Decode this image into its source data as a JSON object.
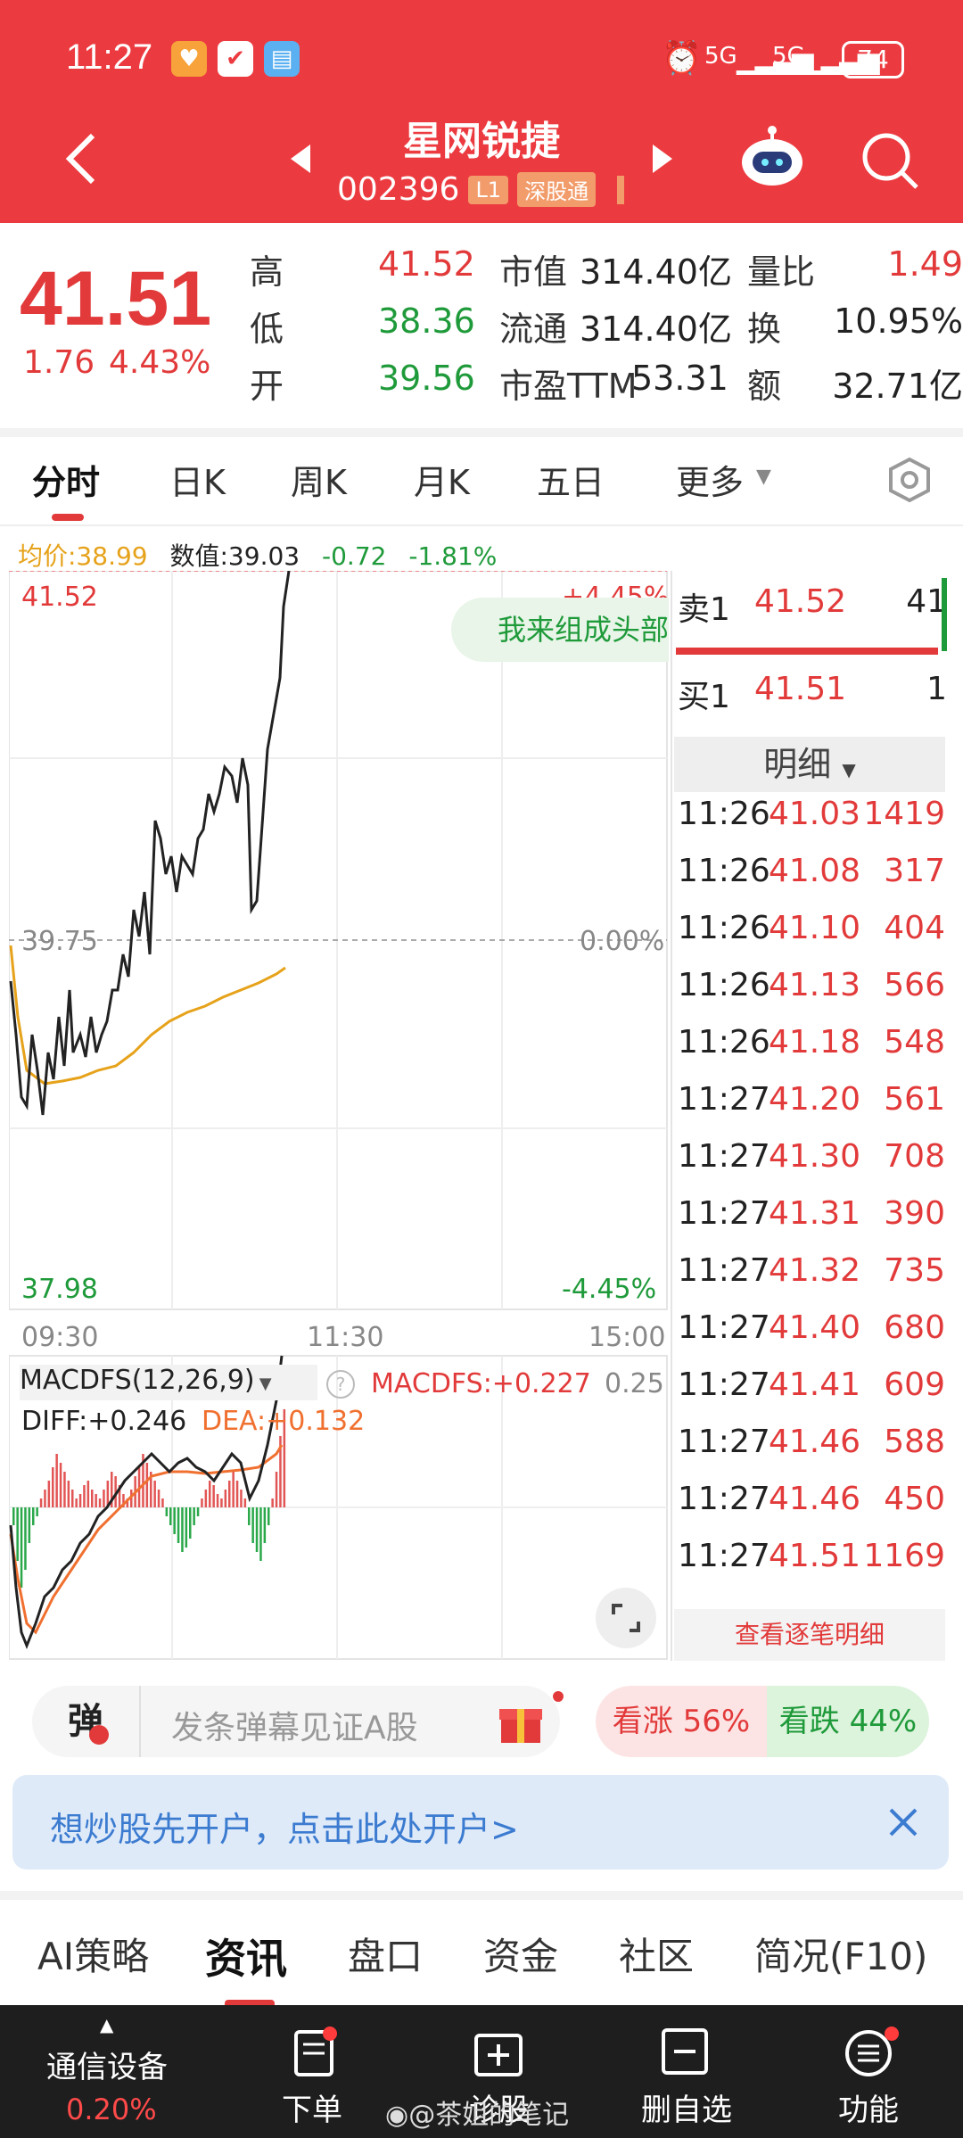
{
  "status_bar": {
    "time": "11:27",
    "signal1": "5G",
    "signal2": "5G",
    "battery": "74"
  },
  "header": {
    "title": "星网锐捷",
    "code": "002396",
    "badge_level": "L1",
    "badge_market": "深股通"
  },
  "quote": {
    "price": "41.51",
    "change": "1.76",
    "change_pct": "4.43%",
    "rows": [
      {
        "l1": "高",
        "v1": "41.52",
        "l2": "市值",
        "v2": "314.40亿",
        "l3": "量比",
        "v3": "1.49"
      },
      {
        "l1": "低",
        "v1": "38.36",
        "l2": "流通",
        "v2": "314.40亿",
        "l3": "换",
        "v3": "10.95%"
      },
      {
        "l1": "开",
        "v1": "39.56",
        "l2": "市盈TTM",
        "v2": "53.31",
        "l3": "额",
        "v3": "32.71亿"
      }
    ]
  },
  "tabs": [
    "分时",
    "日K",
    "周K",
    "月K",
    "五日",
    "更多"
  ],
  "info_line": {
    "avg_label": "均价:38.99",
    "value_label": "数值:39.03",
    "chg": "-0.72",
    "chg_pct": "-1.81%"
  },
  "chart_labels": {
    "top_price": "41.52",
    "top_pct": "+4.45%",
    "mid_price": "39.75",
    "mid_pct": "0.00%",
    "bottom_price": "37.98",
    "bottom_pct": "-4.45%",
    "time_start": "09:30",
    "time_mid": "11:30",
    "time_end": "15:00",
    "bubble": "我来组成头部"
  },
  "macd": {
    "name": "MACDFS(12,26,9)",
    "macdfs": "MACDFS:+0.227",
    "scale": "0.25",
    "diff": "DIFF:+0.246",
    "dea": "DEA:+0.132"
  },
  "order_book": {
    "sell": {
      "label": "卖1",
      "price": "41.52",
      "qty": "41"
    },
    "buy": {
      "label": "买1",
      "price": "41.51",
      "qty": "1"
    }
  },
  "detail": {
    "header": "明细",
    "rows": [
      {
        "t": "11:26",
        "p": "41.03",
        "q": "1419"
      },
      {
        "t": "11:26",
        "p": "41.08",
        "q": "317"
      },
      {
        "t": "11:26",
        "p": "41.10",
        "q": "404"
      },
      {
        "t": "11:26",
        "p": "41.13",
        "q": "566"
      },
      {
        "t": "11:26",
        "p": "41.18",
        "q": "548"
      },
      {
        "t": "11:27",
        "p": "41.20",
        "q": "561"
      },
      {
        "t": "11:27",
        "p": "41.30",
        "q": "708"
      },
      {
        "t": "11:27",
        "p": "41.31",
        "q": "390"
      },
      {
        "t": "11:27",
        "p": "41.32",
        "q": "735"
      },
      {
        "t": "11:27",
        "p": "41.40",
        "q": "680"
      },
      {
        "t": "11:27",
        "p": "41.41",
        "q": "609"
      },
      {
        "t": "11:27",
        "p": "41.46",
        "q": "588"
      },
      {
        "t": "11:27",
        "p": "41.46",
        "q": "450"
      },
      {
        "t": "11:27",
        "p": "41.51",
        "q": "1169"
      }
    ],
    "more": "查看逐笔明细"
  },
  "danmu": {
    "label": "弹",
    "placeholder": "发条弹幕见证A股",
    "up": "看涨 56%",
    "down": "看跌 44%"
  },
  "banner": {
    "text": "想炒股先开户，点击此处开户>"
  },
  "section_tabs": [
    "AI策略",
    "资讯",
    "盘口",
    "资金",
    "社区",
    "简况(F10)"
  ],
  "bottom_nav": {
    "sector": "通信设备",
    "sector_pct": "0.20%",
    "items": [
      "下单",
      "诊股",
      "删自选",
      "功能"
    ],
    "watermark": "@茶姐的笔记"
  },
  "colors": {
    "brand": "#ec3b40",
    "up": "#e23a3a",
    "down": "#1f9a3a",
    "avg": "#e6a21a"
  }
}
